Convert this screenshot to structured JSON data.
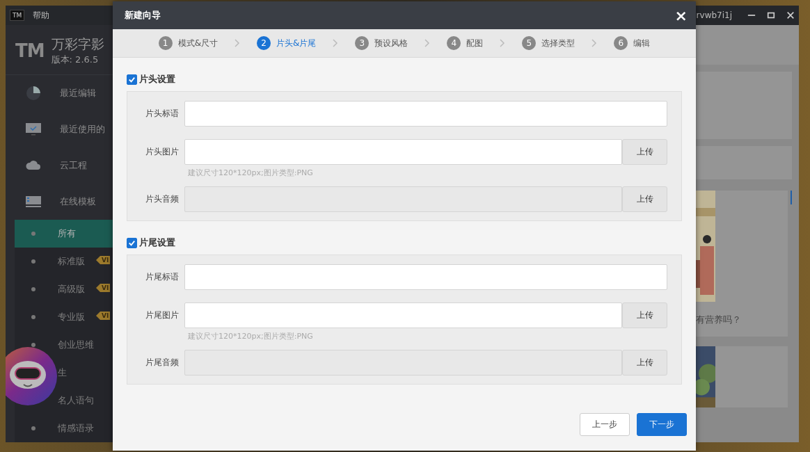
{
  "app": {
    "badge": "TM",
    "menu": [
      "帮助"
    ],
    "logo": "TM",
    "name": "万彩字影",
    "version": "版本: 2.6.5",
    "user": "rvwb7i1j",
    "nav": [
      {
        "label": "最近编辑",
        "kind": "pie"
      },
      {
        "label": "最近使用的",
        "kind": "monitor"
      },
      {
        "label": "云工程",
        "kind": "cloud"
      },
      {
        "label": "在线模板",
        "kind": "template"
      }
    ],
    "sub_items": [
      {
        "label": "所有",
        "selected": true
      },
      {
        "label": "标准版",
        "selected": false,
        "badge": "VI"
      },
      {
        "label": "高级版",
        "selected": false,
        "badge": "VI"
      },
      {
        "label": "专业版",
        "selected": false,
        "badge": "VI"
      },
      {
        "label": "创业思维",
        "selected": false
      },
      {
        "label": "生",
        "selected": false
      },
      {
        "label": "名人语句",
        "selected": false
      },
      {
        "label": "情感语录",
        "selected": false
      }
    ],
    "card_caption": "有营养吗？"
  },
  "dialog": {
    "title": "新建向导",
    "close": "×",
    "steps": [
      {
        "number": "1",
        "label": "模式&尺寸",
        "selected": false
      },
      {
        "number": "2",
        "label": "片头&片尾",
        "selected": true
      },
      {
        "number": "3",
        "label": "预设风格",
        "selected": false
      },
      {
        "number": "4",
        "label": "配图",
        "selected": false
      },
      {
        "number": "5",
        "label": "选择类型",
        "selected": false
      },
      {
        "number": "6",
        "label": "编辑",
        "selected": false
      }
    ],
    "sections": [
      {
        "title": "片头设置",
        "checked": true,
        "fields": [
          {
            "kind": "text",
            "label": "片头标语"
          },
          {
            "kind": "upload",
            "label": "片头图片",
            "button": "上传",
            "hint": "建议尺寸120*120px;图片类型:PNG"
          },
          {
            "kind": "audio",
            "label": "片头音频",
            "button": "上传"
          }
        ]
      },
      {
        "title": "片尾设置",
        "checked": true,
        "fields": [
          {
            "kind": "text",
            "label": "片尾标语"
          },
          {
            "kind": "upload",
            "label": "片尾图片",
            "button": "上传",
            "hint": "建议尺寸120*120px;图片类型:PNG"
          },
          {
            "kind": "audio",
            "label": "片尾音频",
            "button": "上传"
          }
        ]
      }
    ],
    "buttons": [
      {
        "label": "上一步",
        "kind": "secondary"
      },
      {
        "label": "下一步",
        "kind": "primary"
      }
    ]
  }
}
